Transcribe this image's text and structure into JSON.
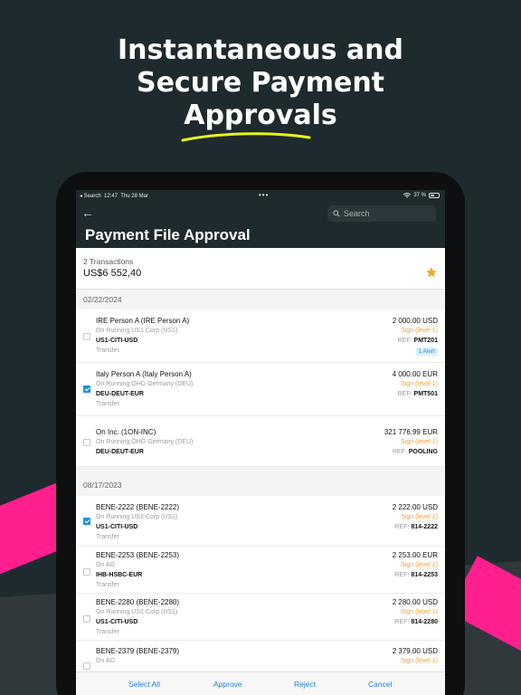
{
  "hero": {
    "line1": "Instantaneous and",
    "line2": "Secure Payment",
    "line3": "Approvals"
  },
  "colors": {
    "accent": "#ff1f8e",
    "highlight": "#e8f51a",
    "link": "#1d7fd6",
    "sign": "#f0a030"
  },
  "status_bar": {
    "back_label": "◂ Search",
    "time": "12:47",
    "date": "Thu 28 Mar",
    "battery": "37 %"
  },
  "nav": {
    "back_icon": "back-arrow-icon",
    "search_placeholder": "Search",
    "title": "Payment File Approval"
  },
  "summary": {
    "count": "2 Transactions",
    "total": "US$6 552,40"
  },
  "sections": [
    {
      "date": "02/22/2024",
      "rows": [
        {
          "name": "IRE Person A (IRE Person A)",
          "sub": "On Running US1 Corp (US1)",
          "account": "US1-CITI-USD",
          "type": "Transfer",
          "amount": "2 000.00 USD",
          "sign": "Sign (level 1)",
          "ref_label": "REF:",
          "ref": "PMT201",
          "alert": "1 Alert",
          "checked": false
        },
        {
          "name": "Italy Person A (Italy Person A)",
          "sub": "On Running OHG Germany (DEU)",
          "account": "DEU-DEUT-EUR",
          "type": "Transfer",
          "amount": "4 000.00 EUR",
          "sign": "Sign (level 1)",
          "ref_label": "REF:",
          "ref": "PMT501",
          "checked": true
        },
        {
          "name": "On Inc. (1ON-INC)",
          "sub": "On Running OHG Germany (DEU)",
          "account": "DEU-DEUT-EUR",
          "type": "",
          "amount": "321 776.99 EUR",
          "sign": "Sign (level 1)",
          "ref_label": "REF:",
          "ref": "POOLING",
          "checked": false
        }
      ]
    },
    {
      "date": "08/17/2023",
      "rows": [
        {
          "name": "BENE-2222 (BENE-2222)",
          "sub": "On Running US1 Corp (US1)",
          "account": "US1-CITI-USD",
          "type": "Transfer",
          "amount": "2 222.00 USD",
          "sign": "Sign (level 1)",
          "ref_label": "REF:",
          "ref": "814-2222",
          "checked": true
        },
        {
          "name": "BENE-2253 (BENE-2253)",
          "sub": "On AG",
          "account": "IHB-HSBC-EUR",
          "type": "Transfer",
          "amount": "2 253.00 EUR",
          "sign": "Sign (level 1)",
          "ref_label": "REF:",
          "ref": "814-2253",
          "checked": false
        },
        {
          "name": "BENE-2280 (BENE-2280)",
          "sub": "On Running US1 Corp (US1)",
          "account": "US1-CITI-USD",
          "type": "Transfer",
          "amount": "2 280.00 USD",
          "sign": "Sign (level 1)",
          "ref_label": "REF:",
          "ref": "814-2280",
          "checked": false
        },
        {
          "name": "BENE-2379 (BENE-2379)",
          "sub": "On AG",
          "account": "",
          "type": "",
          "amount": "2 379.00 USD",
          "sign": "Sign (level 1)",
          "ref_label": "",
          "ref": "",
          "checked": false
        }
      ]
    }
  ],
  "toolbar": {
    "select_all": "Select All",
    "approve": "Approve",
    "reject": "Reject",
    "cancel": "Cancel"
  }
}
